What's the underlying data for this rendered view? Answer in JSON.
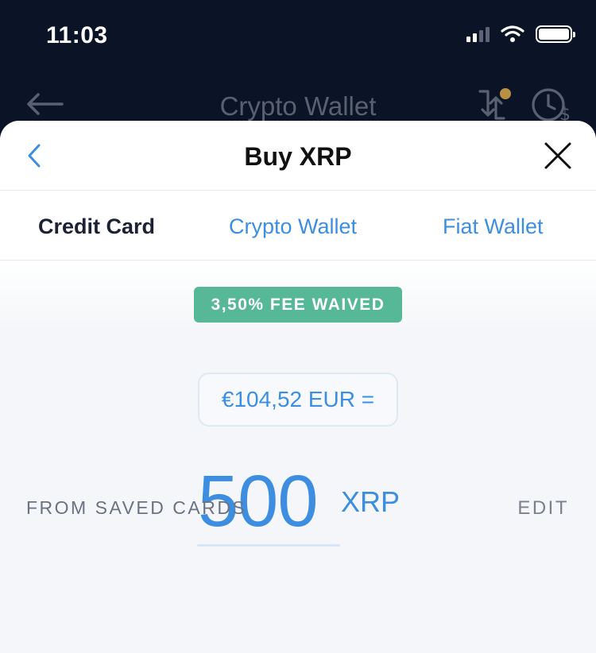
{
  "status_bar": {
    "time": "11:03",
    "icons": [
      "signal-icon",
      "wifi-icon",
      "battery-icon"
    ]
  },
  "background_header": {
    "title": "Crypto Wallet",
    "icons": [
      "back-arrow-icon",
      "transfer-icon",
      "history-icon"
    ],
    "notification_dot_color": "#b89043"
  },
  "sheet": {
    "title": "Buy XRP",
    "back_icon": "chevron-left-icon",
    "close_icon": "close-icon"
  },
  "tabs": [
    {
      "label": "Credit Card",
      "active": true
    },
    {
      "label": "Crypto Wallet",
      "active": false
    },
    {
      "label": "Fiat Wallet",
      "active": false
    }
  ],
  "purchase": {
    "fee_badge": "3,50% FEE WAIVED",
    "fiat_equivalent": "€104,52 EUR =",
    "amount": "500",
    "unit": "XRP"
  },
  "saved_cards": {
    "label": "FROM SAVED CARDS",
    "edit_label": "EDIT"
  },
  "colors": {
    "accent": "#3d8ee0",
    "fee_badge": "#56b897",
    "background_dark": "#0b1426"
  }
}
